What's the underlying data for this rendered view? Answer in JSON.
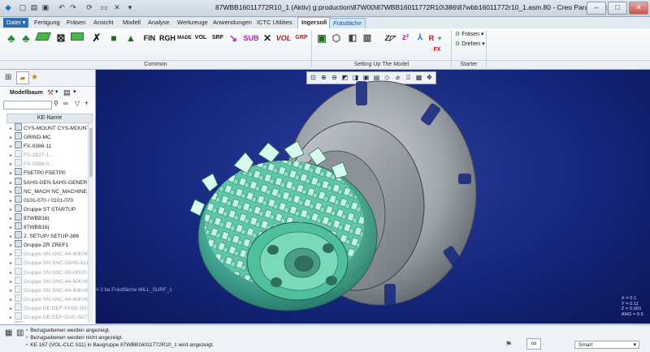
{
  "window": {
    "title": "87WBB16011772R10_1 (Aktiv) g:production\\87W00\\87WBB16011772R10\\386\\87wbb16011772r10_1.asm.80 - Creo Parametric"
  },
  "menu_tabs": [
    {
      "label": "Datei ▾",
      "active": false
    },
    {
      "label": "Fertigung",
      "active": false
    },
    {
      "label": "Fräsen",
      "active": false
    },
    {
      "label": "Ansicht",
      "active": false
    },
    {
      "label": "Modell",
      "active": false
    },
    {
      "label": "Analyse",
      "active": false
    },
    {
      "label": "Werkzeuge",
      "active": false
    },
    {
      "label": "Anwendungen",
      "active": false
    },
    {
      "label": "ICTC Utilities",
      "active": false
    },
    {
      "label": "Ingersoll",
      "active": true
    },
    {
      "label": "Frästläche",
      "active": false
    }
  ],
  "ribbon": {
    "common_icons": [
      "FIN",
      "RGH",
      "MADE",
      "VOL",
      "SRF",
      "SUB",
      "VOL",
      "GRP"
    ],
    "groups": {
      "common": "Common",
      "setup": "Setting Up The Model",
      "starter": "Starter"
    },
    "starter_items": {
      "fraesen": "Fräsen ▾",
      "drehen": "Drehen ▾"
    },
    "fx_label": "FX"
  },
  "left_panel": {
    "title": "Modellbaum",
    "column_header": "KE-Name",
    "tree": [
      {
        "label": "CYS-MOUNT CYS-MOUNT-PAR",
        "dim": false
      },
      {
        "label": "GRIND-MC",
        "dim": false
      },
      {
        "label": "FX-0386-11",
        "dim": false
      },
      {
        "label": "FX-2827-1...",
        "dim": true
      },
      {
        "label": "FX-0386-0...",
        "dim": true
      },
      {
        "label": "FSETP0     FSETP0",
        "dim": false
      },
      {
        "label": "5AHS-GEN 5AHS-GENERIC",
        "dim": false
      },
      {
        "label": "NC_MACH NC_MACHINE_SI",
        "dim": false
      },
      {
        "label": "0101-070 / 0101-070",
        "dim": false
      },
      {
        "label": "Gruppe ST STARTUP",
        "dim": false
      },
      {
        "label": "87WBB16(",
        "dim": false
      },
      {
        "label": "87WBB16(",
        "dim": false
      },
      {
        "label": "2. SETUP/ SETUP-386",
        "dim": false
      },
      {
        "label": "Gruppe ZR ZREF1",
        "dim": false
      },
      {
        "label": "Gruppe SN SNC-44-60KH04",
        "dim": true
      },
      {
        "label": "Gruppe SN SNC-55HN-61H",
        "dim": true
      },
      {
        "label": "Gruppe SN SNC-55-H0UT-61",
        "dim": true
      },
      {
        "label": "Gruppe SN SNC-44-60KH04",
        "dim": true
      },
      {
        "label": "Gruppe SN SNC-44-60KH04",
        "dim": true
      },
      {
        "label": "Gruppe SN SNC-44-60KH04",
        "dim": true
      },
      {
        "label": "Gruppe DE DEF-FASE-S01",
        "dim": true
      },
      {
        "label": "Gruppe DE DEF-OVC-S07",
        "dim": true
      },
      {
        "label": "Gruppe DE DEF-FASE-S02",
        "dim": true
      }
    ]
  },
  "viewport": {
    "surface_label": "# 3 ba Frästfläche MILL_SURF_1",
    "coords": [
      "X = 0.1",
      "Y = 0.11",
      "Z = 0.001",
      "ANG = 0.5"
    ]
  },
  "status": {
    "messages": [
      "Bezugsebenen werden angezeigt.",
      "Bezugsebenen werden nicht angezeigt.",
      "KE 167 (VOL-CLC S11) in Baugruppe 87WBB16011772R10_1 wird angezeigt."
    ],
    "filter": "Smart"
  },
  "colors": {
    "viewport_bg": "#15277e",
    "part_grey": "#9ea3aa",
    "highlight_green": "#55c7a6"
  }
}
